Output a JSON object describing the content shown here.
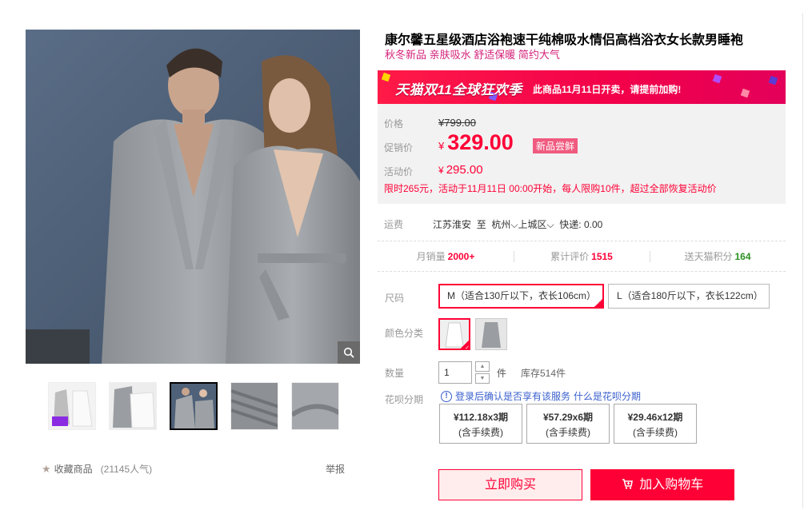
{
  "product": {
    "title": "康尔馨五星级酒店浴袍速干纯棉吸水情侣高档浴衣女长款男睡袍",
    "subtitle": "秋冬新品 亲肤吸水 舒适保暖 简约大气"
  },
  "promo_banner": {
    "logo_text": "天猫双11全球狂欢季",
    "note": "此商品11月11日开卖，请提前加购!"
  },
  "price": {
    "label_price": "价格",
    "original": "¥799.00",
    "label_promo": "促销价",
    "currency": "¥",
    "promo_value": "329.00",
    "new_tag": "新品尝鲜",
    "label_activity": "活动价",
    "activity_value": "295.00",
    "activity_rule": "限时265元，活动于11月11日 00:00开始，每人限购10件，超过全部恢复活动价"
  },
  "shipping": {
    "label": "运费",
    "from": "江苏淮安",
    "to_word": "至",
    "city": "杭州",
    "district": "上城区",
    "express": "快递: 0.00"
  },
  "stats": {
    "monthly_label": "月销量",
    "monthly_value": "2000+",
    "reviews_label": "累计评价",
    "reviews_value": "1515",
    "points_label": "送天猫积分",
    "points_value": "164"
  },
  "options": {
    "size_label": "尺码",
    "sizes": [
      "M（适合130斤以下，衣长106cm）",
      "L（适合180斤以下，衣长122cm）"
    ],
    "selected_size": "M（适合130斤以下，衣长106cm）",
    "color_label": "颜色分类",
    "quantity_label": "数量",
    "quantity_value": "1",
    "unit": "件",
    "stock": "库存514件",
    "huabei_label": "花呗分期",
    "huabei_tip": "登录后确认是否享有该服务",
    "huabei_link": "什么是花呗分期",
    "installments": [
      {
        "amount": "¥112.18x3期",
        "fee": "(含手续费)"
      },
      {
        "amount": "¥57.29x6期",
        "fee": "(含手续费)"
      },
      {
        "amount": "¥29.46x12期",
        "fee": "(含手续费)"
      }
    ]
  },
  "actions": {
    "buy_now": "立即购买",
    "add_to_cart": "加入购物车",
    "collect": "收藏商品",
    "popularity": "(21145人气)",
    "report": "举报"
  },
  "colors": {
    "accent": "#ff0036",
    "subtitle": "#d4237a",
    "link": "#3a5fcd",
    "points": "#2d8f23"
  }
}
